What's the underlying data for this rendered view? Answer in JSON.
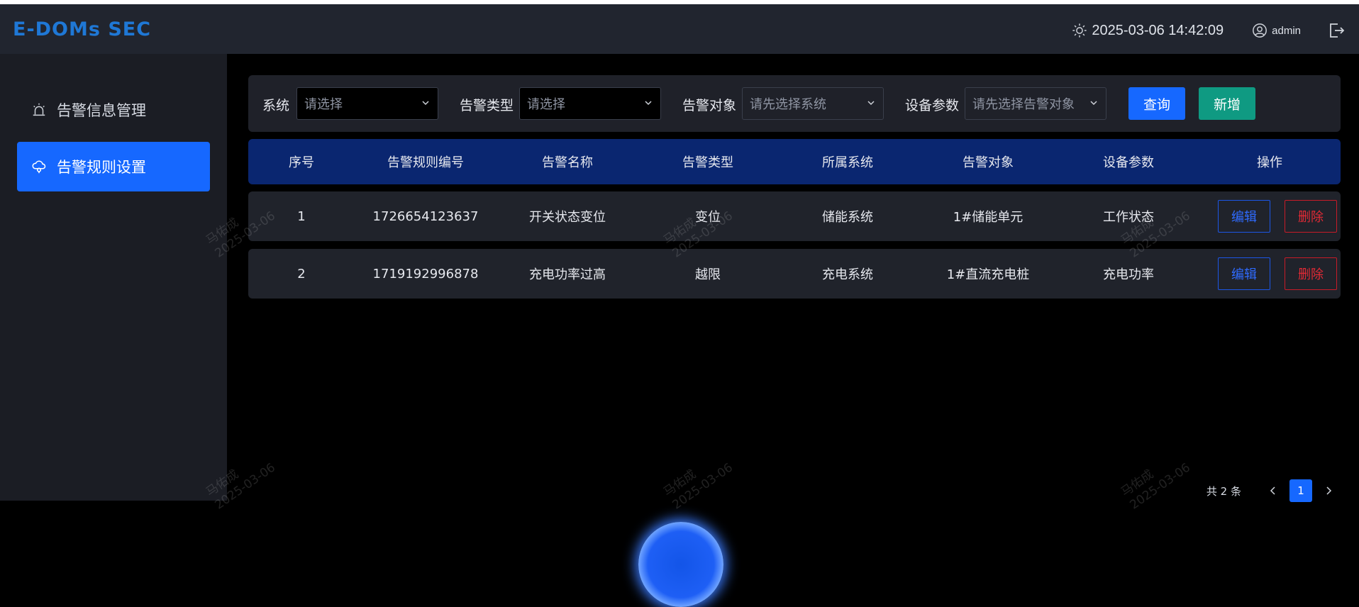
{
  "app": {
    "logo_text": "E-DOMs SEC",
    "datetime": "2025-03-06 14:42:09",
    "username": "admin"
  },
  "icons": {
    "theme": "sun-icon",
    "user": "user-circle-icon",
    "logout": "logout-icon",
    "alarm_info": "alarm-icon",
    "alarm_rule": "cloud-alarm-icon"
  },
  "sidebar": {
    "items": [
      {
        "label": "告警信息管理",
        "active": false
      },
      {
        "label": "告警规则设置",
        "active": true
      }
    ]
  },
  "filters": {
    "system": {
      "label": "系统",
      "placeholder": "请选择"
    },
    "alarm_type": {
      "label": "告警类型",
      "placeholder": "请选择"
    },
    "alarm_object": {
      "label": "告警对象",
      "placeholder": "请先选择系统"
    },
    "device_param": {
      "label": "设备参数",
      "placeholder": "请先选择告警对象"
    },
    "query_label": "查询",
    "add_label": "新增"
  },
  "table": {
    "columns": [
      "序号",
      "告警规则编号",
      "告警名称",
      "告警类型",
      "所属系统",
      "告警对象",
      "设备参数",
      "操作"
    ],
    "rows": [
      {
        "index": "1",
        "rule_id": "1726654123637",
        "name": "开关状态变位",
        "type": "变位",
        "system": "储能系统",
        "object": "1#储能单元",
        "param": "工作状态",
        "edit_label": "编辑",
        "delete_label": "删除"
      },
      {
        "index": "2",
        "rule_id": "1719192996878",
        "name": "充电功率过高",
        "type": "越限",
        "system": "充电系统",
        "object": "1#直流充电桩",
        "param": "充电功率",
        "edit_label": "编辑",
        "delete_label": "删除"
      }
    ]
  },
  "pagination": {
    "total_text": "共 2 条",
    "current_page": "1"
  },
  "watermark": {
    "name": "马佑成",
    "date": "2025-03-06"
  },
  "colors": {
    "primary": "#1668ff",
    "success": "#0f9a82",
    "danger": "#e22a35",
    "table_header": "#0a2670"
  }
}
